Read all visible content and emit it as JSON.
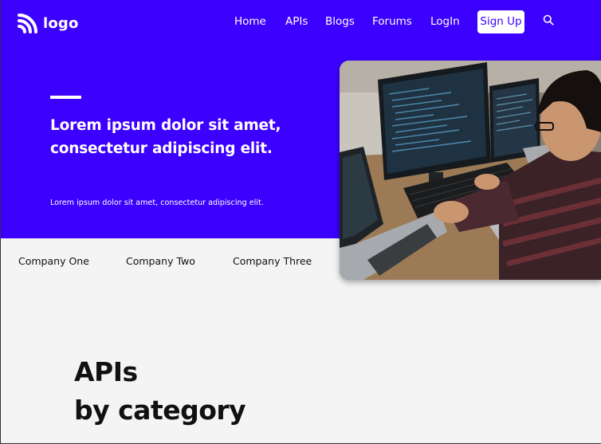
{
  "header": {
    "logo_text": "logo",
    "nav": [
      {
        "label": "Home"
      },
      {
        "label": "APIs"
      },
      {
        "label": "Blogs"
      },
      {
        "label": "Forums"
      },
      {
        "label": "LogIn"
      }
    ],
    "signup_label": "Sign Up",
    "search_icon": "search-icon"
  },
  "hero": {
    "headline_line1": "Lorem ipsum dolor sit amet,",
    "headline_line2": "consectetur adipiscing elit.",
    "subtext": "Lorem ipsum dolor sit amet, consectetur adipiscing elit."
  },
  "companies": [
    "Company One",
    "Company Two",
    "Company Three"
  ],
  "section": {
    "title_line1": "APIs",
    "title_line2": "by category"
  },
  "colors": {
    "brand": "#3c00ff",
    "background": "#f4f4f4",
    "text_dark": "#111111",
    "white": "#ffffff"
  }
}
